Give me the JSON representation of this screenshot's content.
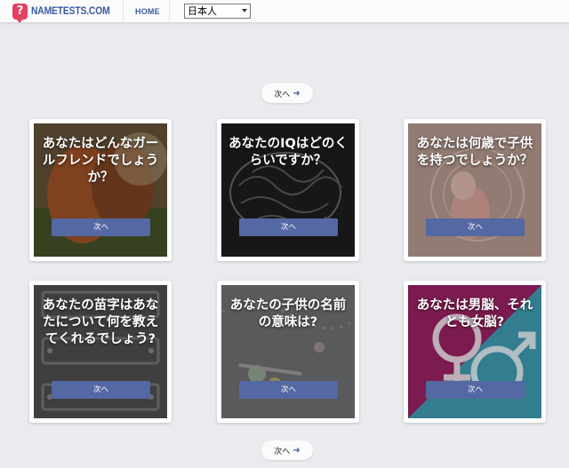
{
  "header": {
    "logo_text": "NAMETESTS.COM",
    "logo_mark": "?",
    "home_label": "HOME",
    "language_selected": "日本人"
  },
  "pagination": {
    "next_label": "次へ",
    "next_arrow": "➜"
  },
  "cards": [
    {
      "title": "あなたはどんなガールフレンドでしょうか？",
      "button": "次へ"
    },
    {
      "title": "あなたのIQはどのくらいですか？",
      "button": "次へ"
    },
    {
      "title": "あなたは何歳で子供を持つでしょうか？",
      "button": "次へ"
    },
    {
      "title": "あなたの苗字はあなたについて何を教えてくれるでしょう?",
      "button": "次へ"
    },
    {
      "title": "あなたの子供の名前の意味は?",
      "button": "次へ"
    },
    {
      "title": "あなたは男脳、それとも女脳?",
      "button": "次へ"
    }
  ],
  "colors": {
    "brand": "#3b5c9e",
    "logo_badge": "#e4405f",
    "button": "#5468a3",
    "page_bg": "#e9ebee"
  }
}
